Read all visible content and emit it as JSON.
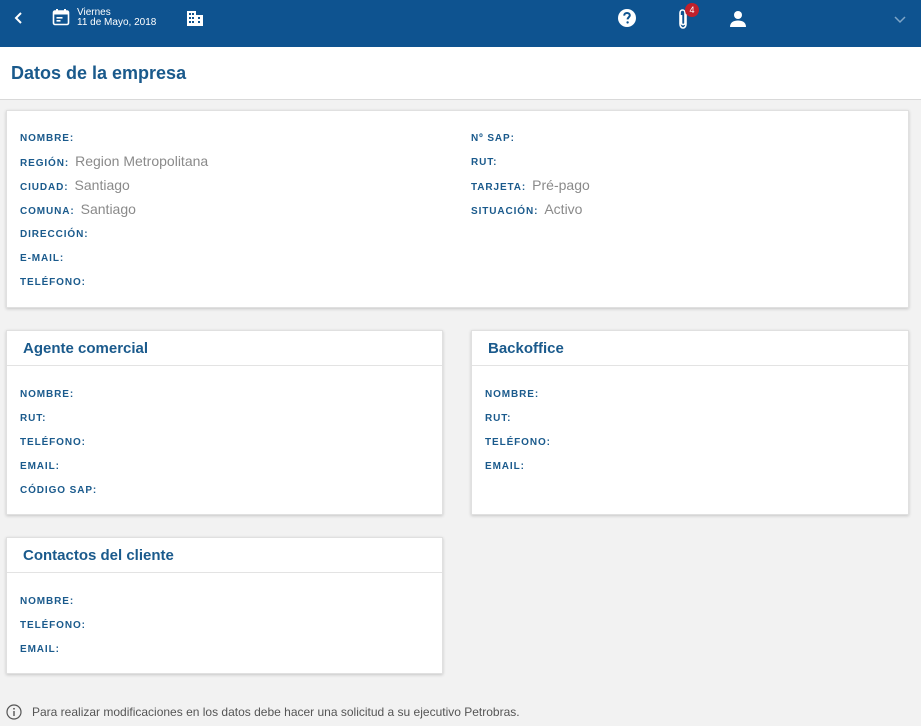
{
  "header": {
    "day": "Viernes",
    "date": "11 de Mayo, 2018",
    "attachments_count": "4",
    "icons": [
      "back-icon",
      "calendar-icon",
      "building-icon",
      "help-icon",
      "paperclip-icon",
      "user-icon",
      "chevron-down-icon"
    ],
    "bg_color": "#0e5390"
  },
  "page": {
    "title": "Datos de la empresa"
  },
  "company": {
    "left": [
      {
        "label": "NOMBRE:",
        "value": ""
      },
      {
        "label": "REGIÓN:",
        "value": "Region Metropolitana"
      },
      {
        "label": "CIUDAD:",
        "value": "Santiago"
      },
      {
        "label": "COMUNA:",
        "value": "Santiago"
      },
      {
        "label": "DIRECCIÓN:",
        "value": ""
      },
      {
        "label": "E-MAIL:",
        "value": ""
      },
      {
        "label": "TELÉFONO:",
        "value": ""
      }
    ],
    "right": [
      {
        "label": "Nº SAP:",
        "value": ""
      },
      {
        "label": "RUT:",
        "value": ""
      },
      {
        "label": "TARJETA:",
        "value": "Pré-pago"
      },
      {
        "label": "SITUACIÓN:",
        "value": "Activo"
      }
    ]
  },
  "agent": {
    "title": "Agente comercial",
    "fields": [
      {
        "label": "NOMBRE:"
      },
      {
        "label": "RUT:"
      },
      {
        "label": "TELÉFONO:"
      },
      {
        "label": "EMAIL:"
      },
      {
        "label": "CÓDIGO SAP:"
      }
    ]
  },
  "backoffice": {
    "title": "Backoffice",
    "fields": [
      {
        "label": "NOMBRE:"
      },
      {
        "label": "RUT:"
      },
      {
        "label": "TELÉFONO:"
      },
      {
        "label": "EMAIL:"
      }
    ]
  },
  "contacts": {
    "title": "Contactos del cliente",
    "fields": [
      {
        "label": "NOMBRE:"
      },
      {
        "label": "TELÉFONO:"
      },
      {
        "label": "EMAIL:"
      }
    ]
  },
  "notice": {
    "text": "Para realizar modificaciones en los datos debe hacer una solicitud a su ejecutivo Petrobras."
  }
}
